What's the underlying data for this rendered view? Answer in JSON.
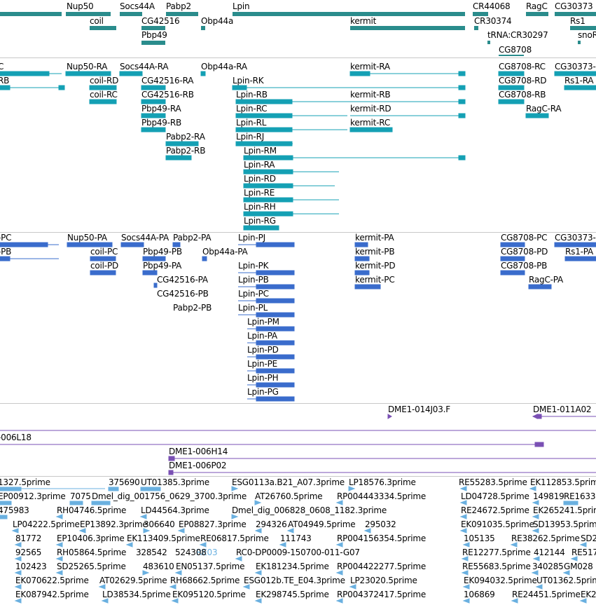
{
  "colors": {
    "gene": "#2a8c8c",
    "transcript_rna": "#14a0b4",
    "transcript_protein": "#3a6ccc",
    "clone": "#7a50b4",
    "est": "#6ab0e0",
    "separator": "#c8c8c8"
  },
  "genes": {
    "labels": [
      "Nup50",
      "Socs44A",
      "Pabp2",
      "Lpin",
      "CR44068",
      "RagC",
      "CG30373",
      "coil",
      "CG42516",
      "Obp44a",
      "kermit",
      "CR30374",
      "Pbp49",
      "tRNA:CR30297",
      "snoR",
      "CG8708",
      "Rs1"
    ]
  },
  "transcripts": {
    "labels": [
      "C",
      "Nup50-RA",
      "Socs44A-RA",
      "Obp44a-RA",
      "kermit-RA",
      "CG8708-RC",
      "CG30373-",
      "RB",
      "coil-RD",
      "CG42516-RA",
      "Lpin-RK",
      "CG8708-RD",
      "Rs1-RA",
      "coil-RC",
      "CG42516-RB",
      "Lpin-RB",
      "kermit-RB",
      "CG8708-RB",
      "Pbp49-RA",
      "Lpin-RC",
      "kermit-RD",
      "RagC-RA",
      "Pbp49-RB",
      "Lpin-RL",
      "kermit-RC",
      "Pabp2-RA",
      "Lpin-RJ",
      "Pabp2-RB",
      "Lpin-RM",
      "Lpin-RA",
      "Lpin-RD",
      "Lpin-RE",
      "Lpin-RH",
      "Lpin-RG"
    ]
  },
  "proteins": {
    "labels": [
      "-PC",
      "Nup50-PA",
      "Socs44A-PA",
      "Pabp2-PA",
      "Lpin-PJ",
      "kermit-PA",
      "CG8708-PC",
      "CG30373-",
      "-PB",
      "coil-PC",
      "Pbp49-PB",
      "Obp44a-PA",
      "kermit-PB",
      "CG8708-PD",
      "Rs1-PA",
      "coil-PD",
      "Pbp49-PA",
      "Lpin-PK",
      "kermit-PD",
      "CG8708-PB",
      "CG42516-PA",
      "Lpin-PB",
      "kermit-PC",
      "RagC-PA",
      "CG42516-PB",
      "Lpin-PC",
      "Pabp2-PB",
      "Lpin-PL",
      "Lpin-PM",
      "Lpin-PA",
      "Lpin-PD",
      "Lpin-PE",
      "Lpin-PH",
      "Lpin-PG"
    ]
  },
  "clones": {
    "labels": [
      "DME1-014J03.F",
      "DME1-011A02",
      "-006L18",
      "DME1-006H14",
      "DME1-006P02"
    ]
  },
  "ests": {
    "labels": [
      "1327.5prime",
      "375690",
      "UT01385.3prime",
      "ESG0113a.B21_A07.3prime",
      "LP18576.3prime",
      "RE55283.5prime",
      "EK112853.5prime",
      "EP00912.3prime",
      "7075",
      "Dmel_dig_001756_0629_3700.3prime",
      "AT26760.5prime",
      "RP004443334.5prime",
      "LD04728.5prime",
      "149819",
      "RE1633",
      "475983",
      "RH04746.5prime",
      "LD44564.3prime",
      "Dmel_dig_006828_0608_1182.3prime",
      "RE24672.5prime",
      "EK265241.5prime",
      "LP04222.5prime",
      "EP13892.3prime",
      "306640",
      "EP08827.3prime",
      "294326",
      "AT04949.5prime",
      "295032",
      "EK091035.5prime",
      "SD13953.5prime",
      "81772",
      "EP10406.3prime",
      "EK113409.5prime",
      "RE06817.5prime",
      "111743",
      "RP004156354.5prime",
      "105135",
      "RE38262.5prime",
      "SD2",
      "92565",
      "RH05864.5prime",
      "RE03",
      "RC0-DP0009-150700-011-G07",
      "RE12277.5prime",
      "412144",
      "RE5171",
      "102423",
      "SD25265.5prime",
      "483610",
      "EN05137.5prime",
      "EK181234.5prime",
      "RP004422277.5prime",
      "RE55683.5prime",
      "340285",
      "GM028",
      "EK070622.5prime",
      "AT02629.5prime",
      "RH68662.5prime",
      "ESG012b.TE_E04.3prime",
      "LP23020.5prime",
      "EK094032.5prime",
      "UT01362.5prime",
      "EK087942.5prime",
      "LD38534.5prime",
      "EK095120.5prime",
      "EK298745.5prime",
      "RP004372417.5prime",
      "106869",
      "RE24451.5prime",
      "EK2",
      "328542",
      "524308"
    ]
  }
}
